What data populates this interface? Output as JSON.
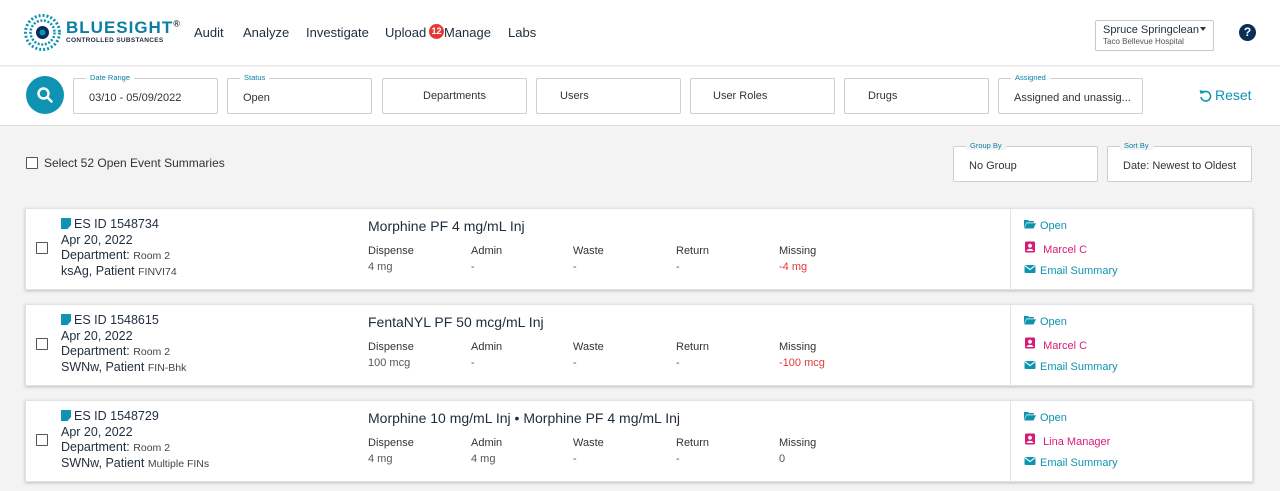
{
  "brand": {
    "name": "BLUESIGHT",
    "reg": "®",
    "tagline": "CONTROLLED SUBSTANCES"
  },
  "nav": [
    {
      "label": "Audit"
    },
    {
      "label": "Analyze"
    },
    {
      "label": "Investigate"
    },
    {
      "label": "Upload"
    },
    {
      "label": "Manage",
      "badge": "12"
    },
    {
      "label": "Labs"
    }
  ],
  "site": {
    "name": "Spruce Springclean",
    "hospital": "Taco Bellevue Hospital"
  },
  "help": "?",
  "filters": {
    "date_range": {
      "label": "Date Range",
      "value": "03/10 - 05/09/2022"
    },
    "status": {
      "label": "Status",
      "value": "Open"
    },
    "departments": "Departments",
    "users": "Users",
    "user_roles": "User Roles",
    "drugs": "Drugs",
    "assigned": {
      "label": "Assigned",
      "value": "Assigned and unassig..."
    },
    "reset": "Reset"
  },
  "select_all": "Select 52 Open Event Summaries",
  "group_by": {
    "label": "Group By",
    "value": "No Group"
  },
  "sort_by": {
    "label": "Sort By",
    "value": "Date: Newest to Oldest"
  },
  "columns": [
    "Dispense",
    "Admin",
    "Waste",
    "Return",
    "Missing"
  ],
  "events": [
    {
      "es_id": "ES ID 1548734",
      "date": "Apr 20, 2022",
      "dept_label": "Department:",
      "dept_value": "Room 2",
      "patient_label": "ksAg, Patient",
      "patient_value": "FINVI74",
      "drug": "Morphine PF 4 mg/mL Inj",
      "values": [
        "4 mg",
        "-",
        "-",
        "-",
        "-4 mg"
      ],
      "status": "Open",
      "assignee": "Marcel C",
      "email": "Email Summary"
    },
    {
      "es_id": "ES ID 1548615",
      "date": "Apr 20, 2022",
      "dept_label": "Department:",
      "dept_value": "Room 2",
      "patient_label": "SWNw, Patient",
      "patient_value": "FIN-Bhk",
      "drug": "FentaNYL PF 50 mcg/mL Inj",
      "values": [
        "100 mcg",
        "-",
        "-",
        "-",
        "-100 mcg"
      ],
      "status": "Open",
      "assignee": "Marcel C",
      "email": "Email Summary"
    },
    {
      "es_id": "ES ID 1548729",
      "date": "Apr 20, 2022",
      "dept_label": "Department:",
      "dept_value": "Room 2",
      "patient_label": "SWNw, Patient",
      "patient_value": "Multiple FINs",
      "drug": "Morphine 10 mg/mL Inj • Morphine PF 4 mg/mL Inj",
      "values": [
        "4 mg",
        "4 mg",
        "-",
        "-",
        "0"
      ],
      "status": "Open",
      "assignee": "Lina Manager",
      "email": "Email Summary"
    }
  ],
  "colors": {
    "accent": "#0f93b3",
    "brand": "#0a7ea4",
    "missing": "#e53935",
    "assignee": "#d81b7a",
    "badge": "#e53935"
  },
  "icons": {
    "search": "search-icon",
    "reset": "refresh-icon",
    "status": "folder-open-icon",
    "assignee": "user-badge-icon",
    "email": "envelope-icon",
    "event": "document-icon"
  }
}
